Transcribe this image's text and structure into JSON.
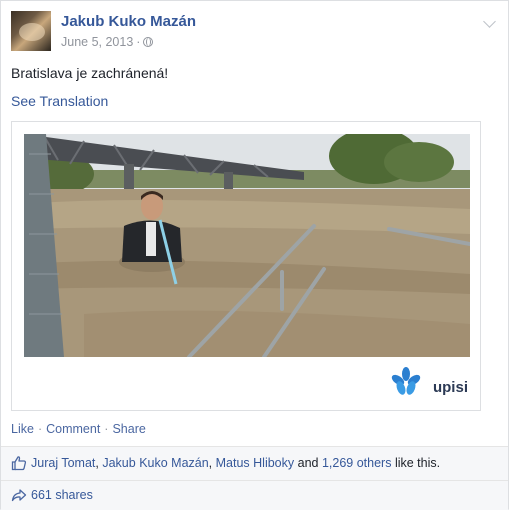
{
  "post": {
    "author": "Jakub Kuko Mazán",
    "date": "June 5, 2013",
    "meta_separator": "·",
    "text": "Bratislava je zachránená!",
    "see_translation": "See Translation",
    "brand_name": "upisi",
    "icons": {
      "privacy": "globe-icon",
      "options": "chevron-down-icon",
      "like": "thumb-icon",
      "share": "share-arrow-icon"
    }
  },
  "actions": {
    "like": "Like",
    "comment": "Comment",
    "share": "Share",
    "separator": "·"
  },
  "likes": {
    "people": [
      "Juraj Tomat",
      "Jakub Kuko Mazán",
      "Matus Hliboky"
    ],
    "comma": ",",
    "and": "and",
    "others": "1,269 others",
    "suffix": "like this."
  },
  "shares": {
    "label": "661 shares"
  },
  "colors": {
    "link": "#365899",
    "muted": "#90949c",
    "text": "#1d2129",
    "row_bg": "#f6f7f9",
    "brand": "#2c3a55"
  }
}
